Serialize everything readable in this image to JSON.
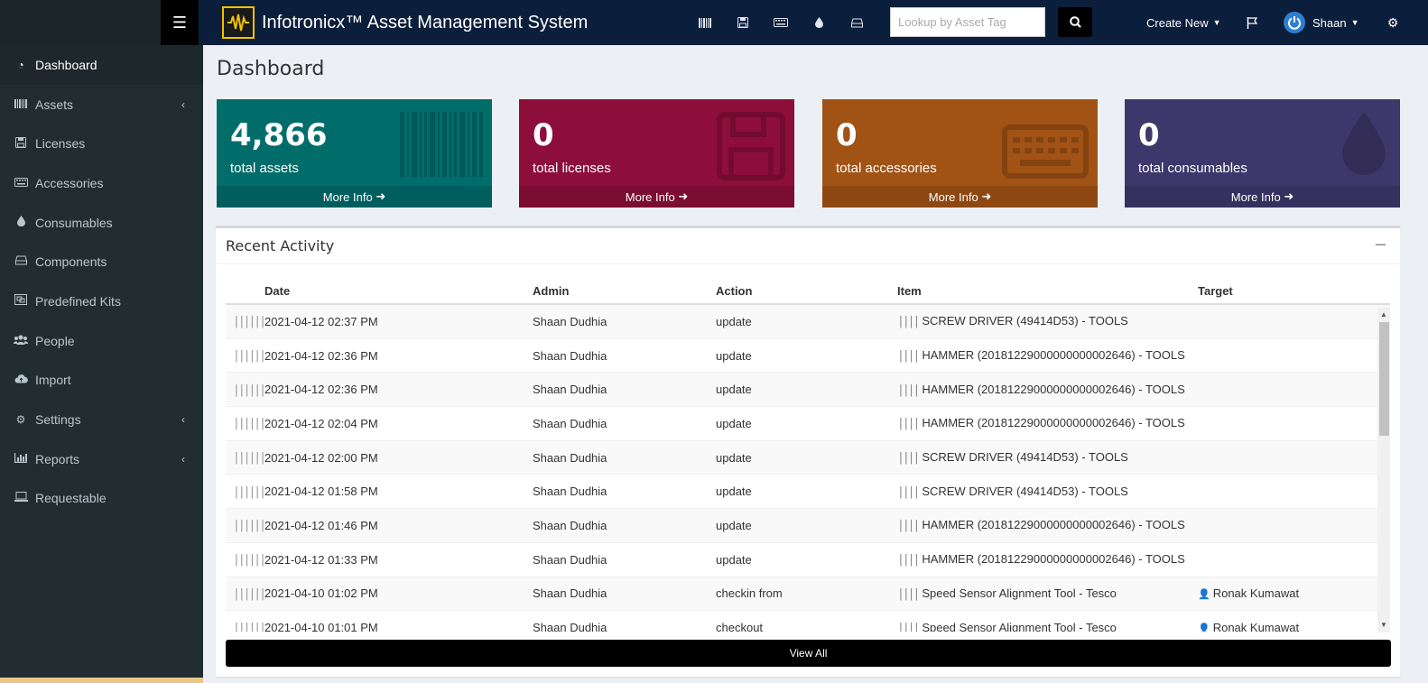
{
  "app": {
    "title": "Infotronicx™ Asset Management System",
    "logo_text": "INFOTRONICX"
  },
  "topnav": {
    "search_placeholder": "Lookup by Asset Tag",
    "create_new": "Create New",
    "user_name": "Shaan"
  },
  "sidebar": {
    "items": [
      {
        "label": "Dashboard",
        "icon": "dashboard-icon"
      },
      {
        "label": "Assets",
        "icon": "barcode-icon"
      },
      {
        "label": "Licenses",
        "icon": "floppy-icon"
      },
      {
        "label": "Accessories",
        "icon": "keyboard-icon"
      },
      {
        "label": "Consumables",
        "icon": "tint-icon"
      },
      {
        "label": "Components",
        "icon": "hdd-icon"
      },
      {
        "label": "Predefined Kits",
        "icon": "object-group-icon"
      },
      {
        "label": "People",
        "icon": "users-icon"
      },
      {
        "label": "Import",
        "icon": "cloud-upload-icon"
      },
      {
        "label": "Settings",
        "icon": "gear-icon"
      },
      {
        "label": "Reports",
        "icon": "bar-chart-icon"
      },
      {
        "label": "Requestable",
        "icon": "laptop-icon"
      }
    ]
  },
  "page": {
    "title": "Dashboard"
  },
  "tiles": [
    {
      "value": "4,866",
      "label": "total assets",
      "more": "More Info",
      "color": "#016d6b"
    },
    {
      "value": "0",
      "label": "total licenses",
      "more": "More Info",
      "color": "#8d0e3a"
    },
    {
      "value": "0",
      "label": "total accessories",
      "more": "More Info",
      "color": "#a15315"
    },
    {
      "value": "0",
      "label": "total consumables",
      "more": "More Info",
      "color": "#3e376b"
    }
  ],
  "activity": {
    "title": "Recent Activity",
    "columns": [
      "Date",
      "Admin",
      "Action",
      "Item",
      "Target"
    ],
    "rows": [
      {
        "date": "2021-04-12 02:37 PM",
        "admin": "Shaan Dudhia",
        "action": "update",
        "item": "SCREW DRIVER (49414D53) - TOOLS",
        "target": ""
      },
      {
        "date": "2021-04-12 02:36 PM",
        "admin": "Shaan Dudhia",
        "action": "update",
        "item": "HAMMER (20181229000000000002646) - TOOLS",
        "target": ""
      },
      {
        "date": "2021-04-12 02:36 PM",
        "admin": "Shaan Dudhia",
        "action": "update",
        "item": "HAMMER (20181229000000000002646) - TOOLS",
        "target": ""
      },
      {
        "date": "2021-04-12 02:04 PM",
        "admin": "Shaan Dudhia",
        "action": "update",
        "item": "HAMMER (20181229000000000002646) - TOOLS",
        "target": ""
      },
      {
        "date": "2021-04-12 02:00 PM",
        "admin": "Shaan Dudhia",
        "action": "update",
        "item": "SCREW DRIVER (49414D53) - TOOLS",
        "target": ""
      },
      {
        "date": "2021-04-12 01:58 PM",
        "admin": "Shaan Dudhia",
        "action": "update",
        "item": "SCREW DRIVER (49414D53) - TOOLS",
        "target": ""
      },
      {
        "date": "2021-04-12 01:46 PM",
        "admin": "Shaan Dudhia",
        "action": "update",
        "item": "HAMMER (20181229000000000002646) - TOOLS",
        "target": ""
      },
      {
        "date": "2021-04-12 01:33 PM",
        "admin": "Shaan Dudhia",
        "action": "update",
        "item": "HAMMER (20181229000000000002646) - TOOLS",
        "target": ""
      },
      {
        "date": "2021-04-10 01:02 PM",
        "admin": "Shaan Dudhia",
        "action": "checkin from",
        "item": "Speed Sensor Alignment Tool - Tesco",
        "target": "Ronak Kumawat"
      },
      {
        "date": "2021-04-10 01:01 PM",
        "admin": "Shaan Dudhia",
        "action": "checkout",
        "item": "Speed Sensor Alignment Tool - Tesco",
        "target": "Ronak Kumawat"
      }
    ],
    "view_all": "View All"
  }
}
